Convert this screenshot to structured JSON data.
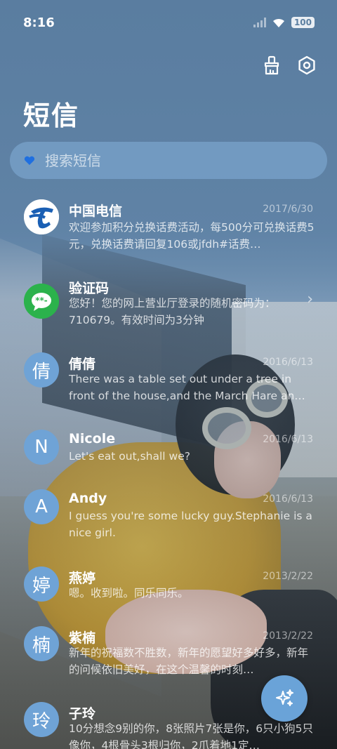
{
  "status": {
    "time": "8:16",
    "battery": "100"
  },
  "header": {
    "title": "短信"
  },
  "search": {
    "placeholder": "搜索短信"
  },
  "threads": [
    {
      "name": "中国电信",
      "date": "2017/6/30",
      "preview": "欢迎参加积分兑换话费活动，每500分可兑换话费5元，兑换话费请回复106或jfdh#话费…",
      "avatar": "telecom-logo"
    },
    {
      "name": "验证码",
      "date": "",
      "preview": "您好！您的网上营业厅登录的随机密码为：710679。有效时间为3分钟",
      "avatar": "message-bubble"
    },
    {
      "name": "倩倩",
      "date": "2016/6/13",
      "preview": "There was a table set out under a tree in front of the house,and the March Hare an…",
      "avatar": "倩"
    },
    {
      "name": "Nicole",
      "date": "2016/6/13",
      "preview": "Let's eat out,shall we?",
      "avatar": "N"
    },
    {
      "name": "Andy",
      "date": "2016/6/13",
      "preview": "I guess you're some lucky guy.Stephanie is a nice girl.",
      "avatar": "A"
    },
    {
      "name": "燕婷",
      "date": "2013/2/22",
      "preview": "嗯。收到啦。同乐同乐。",
      "avatar": "婷"
    },
    {
      "name": "紫楠",
      "date": "2013/2/22",
      "preview": "新年的祝福数不胜数，新年的愿望好多好多，新年的问候依旧美好，在这个温馨的时刻…",
      "avatar": "楠"
    },
    {
      "name": "子玲",
      "date": "",
      "preview": "10分想念9别的你，8张照片7张是你，6只小狗5只像你，4根骨头3根归你，2爪着地1定…",
      "avatar": "玲"
    }
  ],
  "colors": {
    "accent": "#6aa3d8",
    "avatar_bg": "#6fa3d6"
  }
}
